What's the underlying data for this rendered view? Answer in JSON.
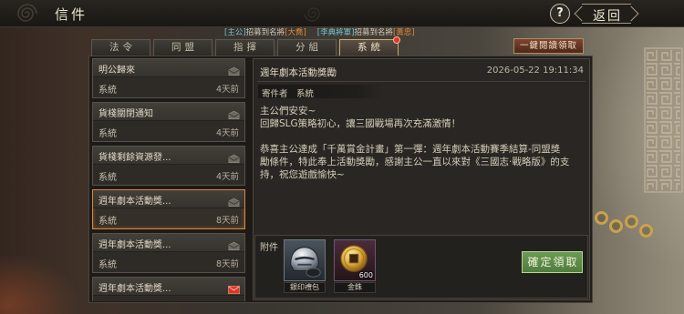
{
  "window": {
    "title": "信件"
  },
  "header": {
    "help_label": "?",
    "back_label": "返回"
  },
  "ticker": [
    {
      "name": "[主公]",
      "action": "招募到名將",
      "general": "[大喬]"
    },
    {
      "name": "[李典將軍]",
      "action": "招募到名將",
      "general": "[黃忠]"
    }
  ],
  "tabs": [
    {
      "label": "法令"
    },
    {
      "label": "同盟"
    },
    {
      "label": "指揮"
    },
    {
      "label": "分組"
    },
    {
      "label": "系統",
      "active": true,
      "has_notification_dot": true
    }
  ],
  "read_all_button": {
    "label": "一鍵閱讀領取"
  },
  "mail_list": [
    {
      "title": "明公歸來",
      "sender": "系統",
      "time": "4天前",
      "icon": "opened-envelope-icon"
    },
    {
      "title": "貨棧關閉通知",
      "sender": "系統",
      "time": "4天前",
      "icon": "opened-envelope-icon"
    },
    {
      "title": "貨棧剩餘資源發...",
      "sender": "系統",
      "time": "4天前",
      "icon": "opened-envelope-icon"
    },
    {
      "title": "週年劇本活動獎...",
      "sender": "系統",
      "time": "8天前",
      "icon": "opened-envelope-icon",
      "selected": true
    },
    {
      "title": "週年劇本活動獎...",
      "sender": "系統",
      "time": "8天前",
      "icon": "opened-envelope-icon"
    },
    {
      "title": "週年劇本活動獎...",
      "icon": "unread-envelope-icon"
    }
  ],
  "mail_detail": {
    "title": "週年劇本活動獎勵",
    "datetime": "2026-05-22 19:11:34",
    "sender_label": "寄件者",
    "sender": "系統",
    "greeting": "主公們安安~",
    "intro": "回歸SLG策略初心，讓三國戰場再次充滿激情！",
    "message_lines": [
      "恭喜主公達成「千萬賞金計畫」第一彈：週年劇本活動賽季結算-同盟獎",
      "勵條件，特此奉上活動獎勵，感謝主公一直以來對《三國志·戰略版》的支",
      "持，祝您遊戲愉快~"
    ],
    "attachments_label": "附件",
    "attachments": [
      {
        "name": "銀印禮包",
        "icon": "silver-seal-pack-icon"
      },
      {
        "name": "金銖",
        "icon": "gold-coin-icon",
        "count": "600"
      }
    ],
    "claim_button": {
      "label": "確定領取"
    }
  },
  "colors": {
    "accent_gold": "#c9a86a",
    "selected_border": "#d8893a",
    "unread_red": "#d93a2e",
    "claim_green": "#4f7d3f",
    "ticker_name": "#73c4cf",
    "ticker_general": "#e48b3c"
  }
}
